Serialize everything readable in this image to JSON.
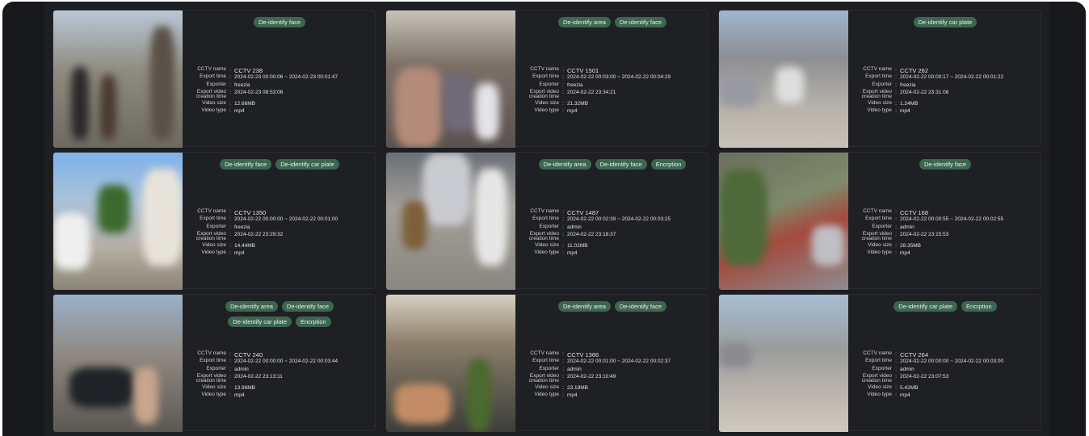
{
  "labels": {
    "cctv_name": "CCTV name",
    "export_time": "Export time",
    "exporter": "Exporter",
    "export_video_creation_time_line1": "Export video",
    "export_video_creation_time_line2": "creation time",
    "video_size": "Video size",
    "video_type": "Video type",
    "separator": ":"
  },
  "cards": [
    {
      "tags": [
        "De-identify face"
      ],
      "cctv_name": "CCTV 238",
      "export_time": "2024-02-23 00:00:06 ~ 2024-02-23 00:01:47",
      "exporter": "freezia",
      "creation_time": "2024-02-23 08:53:06",
      "video_size": "12.66MB",
      "video_type": "mp4"
    },
    {
      "tags": [
        "De-identify area",
        "De-identify face"
      ],
      "cctv_name": "CCTV 1501",
      "export_time": "2024-02-22 00:03:00 ~ 2024-02-22 00:04:29",
      "exporter": "freezia",
      "creation_time": "2024-02-22 23:34:21",
      "video_size": "21.32MB",
      "video_type": "mp4"
    },
    {
      "tags": [
        "De-identify car plate"
      ],
      "cctv_name": "CCTV 262",
      "export_time": "2024-02-22 00:00:17 ~ 2024-02-22 00:01:22",
      "exporter": "freezia",
      "creation_time": "2024-02-22 23:31:08",
      "video_size": "1.24MB",
      "video_type": "mp4"
    },
    {
      "tags": [
        "De-identify face",
        "De-identify car plate"
      ],
      "cctv_name": "CCTV 1350",
      "export_time": "2024-02-22 00:00:00 ~ 2024-02-22 00:01:00",
      "exporter": "freezia",
      "creation_time": "2024-02-22 23:29:32",
      "video_size": "14.44MB",
      "video_type": "mp4"
    },
    {
      "tags": [
        "De-identify area",
        "De-identify face",
        "Encrption"
      ],
      "cctv_name": "CCTV 1487",
      "export_time": "2024-02-22 00:02:39 ~ 2024-02-22 00:03:25",
      "exporter": "admin",
      "creation_time": "2024-02-22 23:18:37",
      "video_size": "11.02MB",
      "video_type": "mp4"
    },
    {
      "tags": [
        "De-identify face"
      ],
      "cctv_name": "CCTV 168",
      "export_time": "2024-02-22 00:00:55 ~ 2024-02-22 00:02:55",
      "exporter": "admin",
      "creation_time": "2024-02-22 23:15:53",
      "video_size": "28.35MB",
      "video_type": "mp4"
    },
    {
      "tags": [
        "De-identify area",
        "De-identify face",
        "De-identify car plate",
        "Encrption"
      ],
      "cctv_name": "CCTV 240",
      "export_time": "2024-02-22 00:00:00 ~ 2024-02-22 00:03:44",
      "exporter": "admin",
      "creation_time": "2024-02-22 23:13:11",
      "video_size": "13.96MB",
      "video_type": "mp4"
    },
    {
      "tags": [
        "De-identify area",
        "De-identify face"
      ],
      "cctv_name": "CCTV 1366",
      "export_time": "2024-02-22 00:01:00 ~ 2024-02-22 00:02:37",
      "exporter": "admin",
      "creation_time": "2024-02-22 23:10:49",
      "video_size": "23.19MB",
      "video_type": "mp4"
    },
    {
      "tags": [
        "De-identify car plate",
        "Encrption"
      ],
      "cctv_name": "CCTV 264",
      "export_time": "2024-02-22 00:00:00 ~ 2024-02-22 00:03:00",
      "exporter": "admin",
      "creation_time": "2024-02-22 23:07:53",
      "video_size": "5.42MB",
      "video_type": "mp4"
    }
  ],
  "colors": {
    "background": "#17181b",
    "card": "#1f2024",
    "tag": "#3c6650",
    "text": "#e0e1e3"
  },
  "thumbnail_scenes": [
    "street-sidewalk-pedestrians",
    "shopping-street-blurred-crowd",
    "road-with-parked-cars",
    "street-with-white-car",
    "staircase-blurred-people",
    "aerial-bike-path",
    "street-with-black-car",
    "cafe-entrance-blurred",
    "empty-road"
  ]
}
